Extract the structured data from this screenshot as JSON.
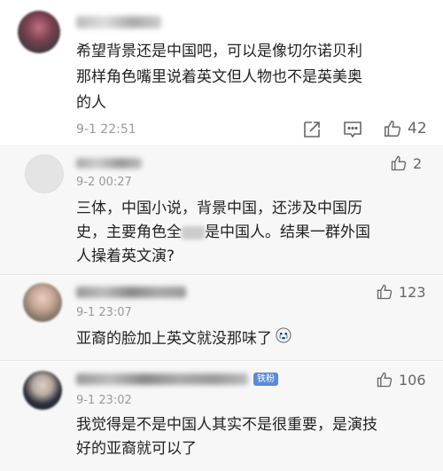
{
  "comments": [
    {
      "text_lines": [
        "希望背景还是中国吧，可以是像切尔诺贝利",
        "那样角色嘴里说着英文但人物也不是英美奥",
        "的人"
      ],
      "time": "9-1 22:51",
      "likes": "42"
    },
    {
      "text_lines": [
        "三体，中国小说，背景中国，还涉及中国历",
        "史，主要角色全",
        "是中国人。结果一群外国",
        "人操着英文演?"
      ],
      "time": "9-2 00:27",
      "likes": "2"
    },
    {
      "text_lines": [
        "亚裔的脸加上英文就没那味了"
      ],
      "time": "9-1 23:07",
      "likes": "123"
    },
    {
      "text_lines": [
        "我觉得是不是中国人其实不是很重要，是演技",
        "好的亚裔就可以了"
      ],
      "time": "9-1 23:02",
      "likes": "106",
      "badge": "铁粉"
    }
  ],
  "colors": {
    "meta": "#9a9a9a",
    "badge": "#5b8bd6"
  }
}
